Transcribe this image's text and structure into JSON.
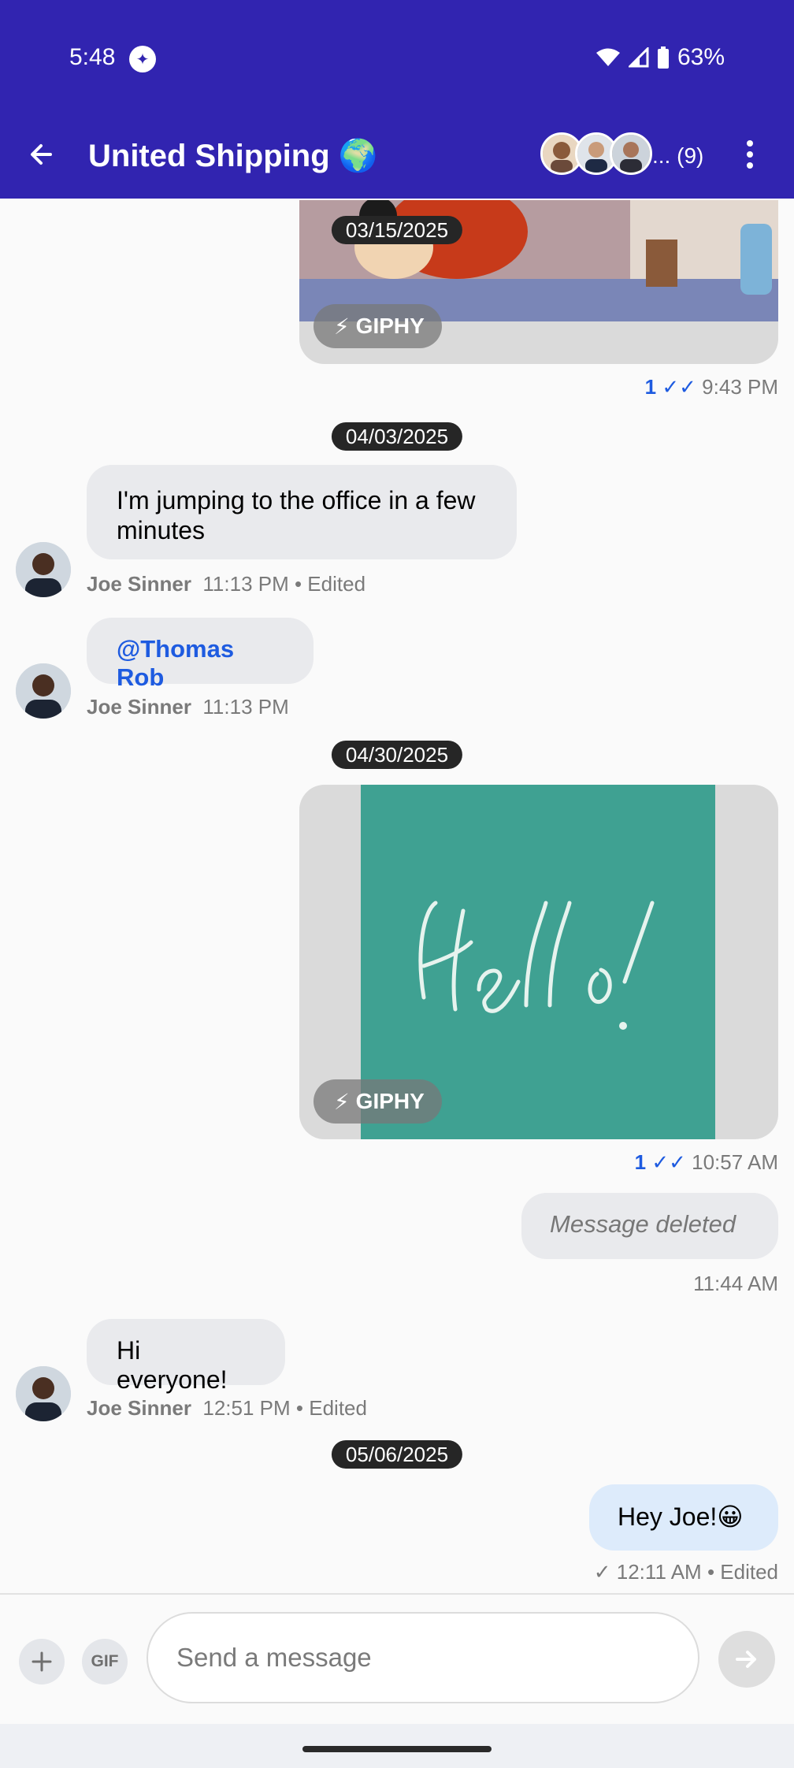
{
  "status_bar": {
    "time": "5:48",
    "battery": "63%"
  },
  "header": {
    "title": "United Shipping 🌍",
    "member_count": "... (9)"
  },
  "messages": {
    "gif1": {
      "date": "03/15/2025",
      "giphy": "GIPHY",
      "read_count": "1",
      "time": "9:43 PM"
    },
    "date2": "04/03/2025",
    "msg1": {
      "text": "I'm jumping to the office in a few minutes",
      "author": "Joe Sinner",
      "time": "11:13 PM",
      "edited": "• Edited"
    },
    "msg2": {
      "text": "@Thomas Rob",
      "author": "Joe Sinner",
      "time": "11:13 PM"
    },
    "date3": "04/30/2025",
    "gif2": {
      "giphy": "GIPHY",
      "read_count": "1",
      "time": "10:57 AM"
    },
    "deleted": {
      "text": "Message deleted",
      "time": "11:44 AM"
    },
    "msg3": {
      "text": "Hi everyone!",
      "author": "Joe Sinner",
      "time": "12:51 PM",
      "edited": "• Edited"
    },
    "date4": "05/06/2025",
    "msg4": {
      "text": "Hey Joe!😀",
      "time": "12:11 AM",
      "edited": "• Edited"
    }
  },
  "composer": {
    "placeholder": "Send a message",
    "gif_label": "GIF"
  },
  "colors": {
    "app_bar": "#3124B0",
    "link": "#1E5BE0",
    "incoming": "#E9EAED",
    "outgoing": "#DDEBFB"
  }
}
